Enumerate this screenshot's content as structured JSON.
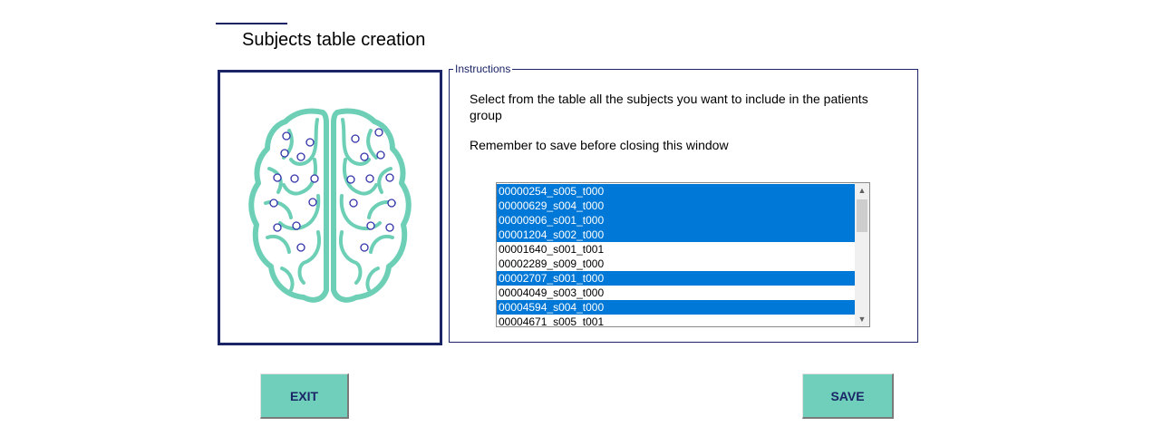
{
  "header": {
    "title": "Subjects table creation"
  },
  "instructions": {
    "legend": "Instructions",
    "line1": "Select from the table all the subjects you want to include in the patients group",
    "line2": "Remember to save before closing this window"
  },
  "subjects": {
    "items": [
      {
        "id": "00000254_s005_t000",
        "selected": true
      },
      {
        "id": "00000629_s004_t000",
        "selected": true
      },
      {
        "id": "00000906_s001_t000",
        "selected": true
      },
      {
        "id": "00001204_s002_t000",
        "selected": true
      },
      {
        "id": "00001640_s001_t001",
        "selected": false
      },
      {
        "id": "00002289_s009_t000",
        "selected": false
      },
      {
        "id": "00002707_s001_t000",
        "selected": true
      },
      {
        "id": "00004049_s003_t000",
        "selected": false
      },
      {
        "id": "00004594_s004_t000",
        "selected": true
      },
      {
        "id": "00004671_s005_t001",
        "selected": false
      }
    ],
    "colors": {
      "selected_bg": "#0078d7",
      "selected_fg": "#ffffff"
    }
  },
  "buttons": {
    "exit_label": "EXIT",
    "save_label": "SAVE"
  },
  "theme": {
    "accent": "#1a2466",
    "button_bg": "#6fcfbb",
    "brain_color": "#6ccfb6",
    "node_color": "#3333aa"
  },
  "icons": {
    "scroll_up": "▲",
    "scroll_down": "▼"
  }
}
